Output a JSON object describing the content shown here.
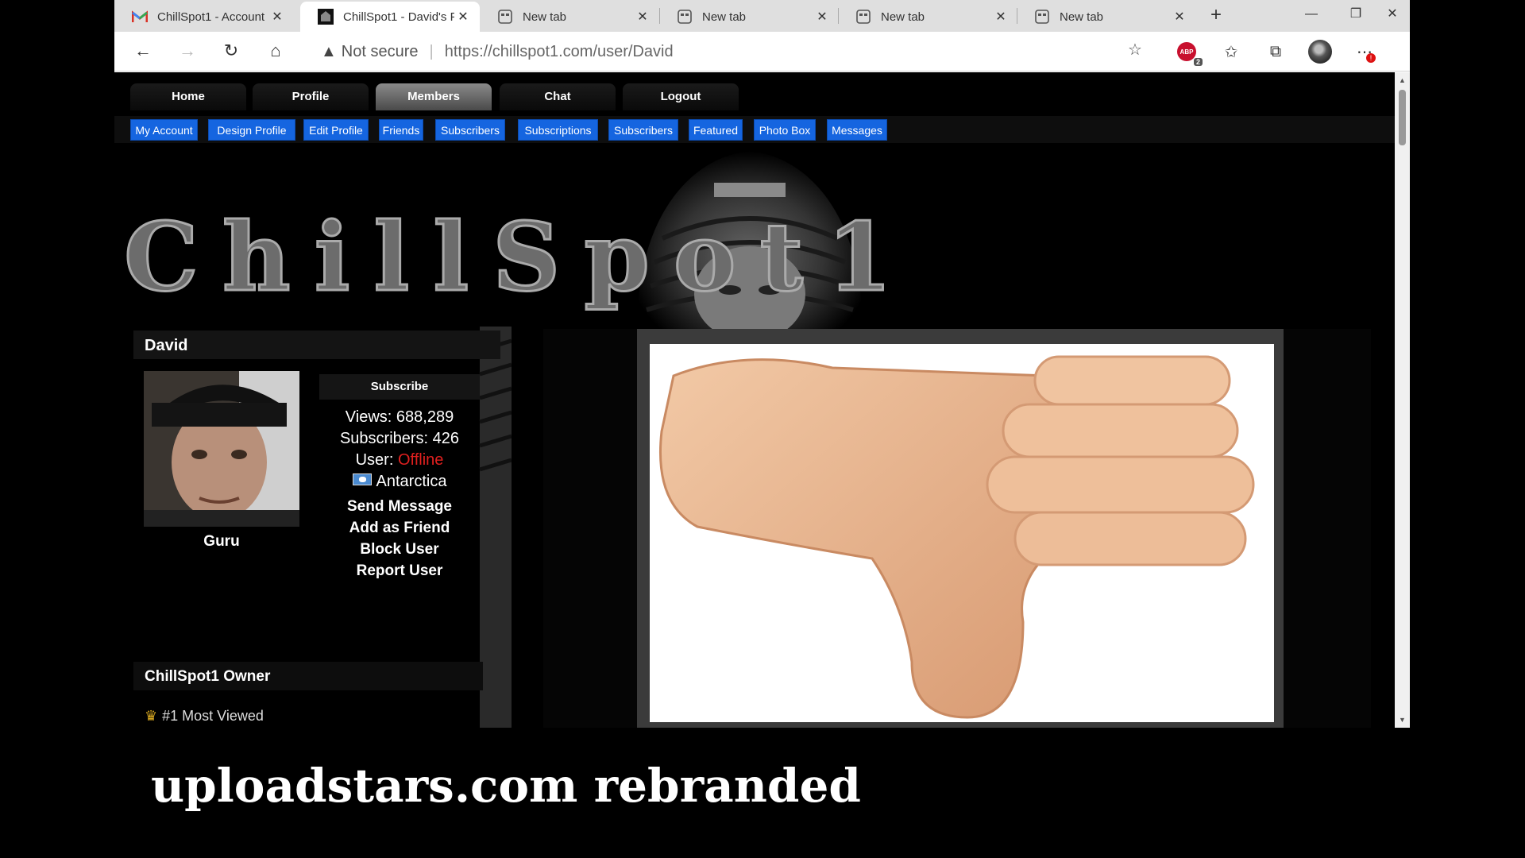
{
  "browser": {
    "tabs": [
      {
        "title": "ChillSpot1 - Account",
        "favicon": "gmail-icon",
        "active": false
      },
      {
        "title": "ChillSpot1 - David's P",
        "favicon": "site-icon",
        "active": true
      },
      {
        "title": "New tab",
        "favicon": "newtab-icon",
        "active": false
      },
      {
        "title": "New tab",
        "favicon": "newtab-icon",
        "active": false
      },
      {
        "title": "New tab",
        "favicon": "newtab-icon",
        "active": false
      },
      {
        "title": "New tab",
        "favicon": "newtab-icon",
        "active": false
      }
    ],
    "security_label": "Not secure",
    "url": "https://chillspot1.com/user/David",
    "adblock_label": "ABP",
    "adblock_count": "2",
    "menu_badge": "!"
  },
  "site": {
    "main_nav": [
      "Home",
      "Profile",
      "Members",
      "Chat",
      "Logout"
    ],
    "main_nav_selected": "Members",
    "sub_nav": [
      "My Account",
      "Design Profile",
      "Edit Profile",
      "Friends",
      "Subscribers",
      "Subscriptions",
      "Subscribers",
      "Featured",
      "Photo Box",
      "Messages"
    ],
    "brand": "ChillSpot1",
    "accent_color": "#1565e0",
    "offline_color": "#e0201f"
  },
  "profile": {
    "username": "David",
    "rank": "Guru",
    "subscribe_label": "Subscribe",
    "views_label": "Views:",
    "views": "688,289",
    "subscribers_label": "Subscribers:",
    "subscribers": "426",
    "status_label": "User:",
    "status": "Offline",
    "location": "Antarctica",
    "actions": [
      "Send Message",
      "Add as Friend",
      "Block User",
      "Report User"
    ],
    "owner_title": "ChillSpot1 Owner",
    "achievement": "#1 Most Viewed"
  },
  "content": {
    "image_icon": "thumbs-down-icon"
  },
  "caption": "uploadstars.com rebranded"
}
